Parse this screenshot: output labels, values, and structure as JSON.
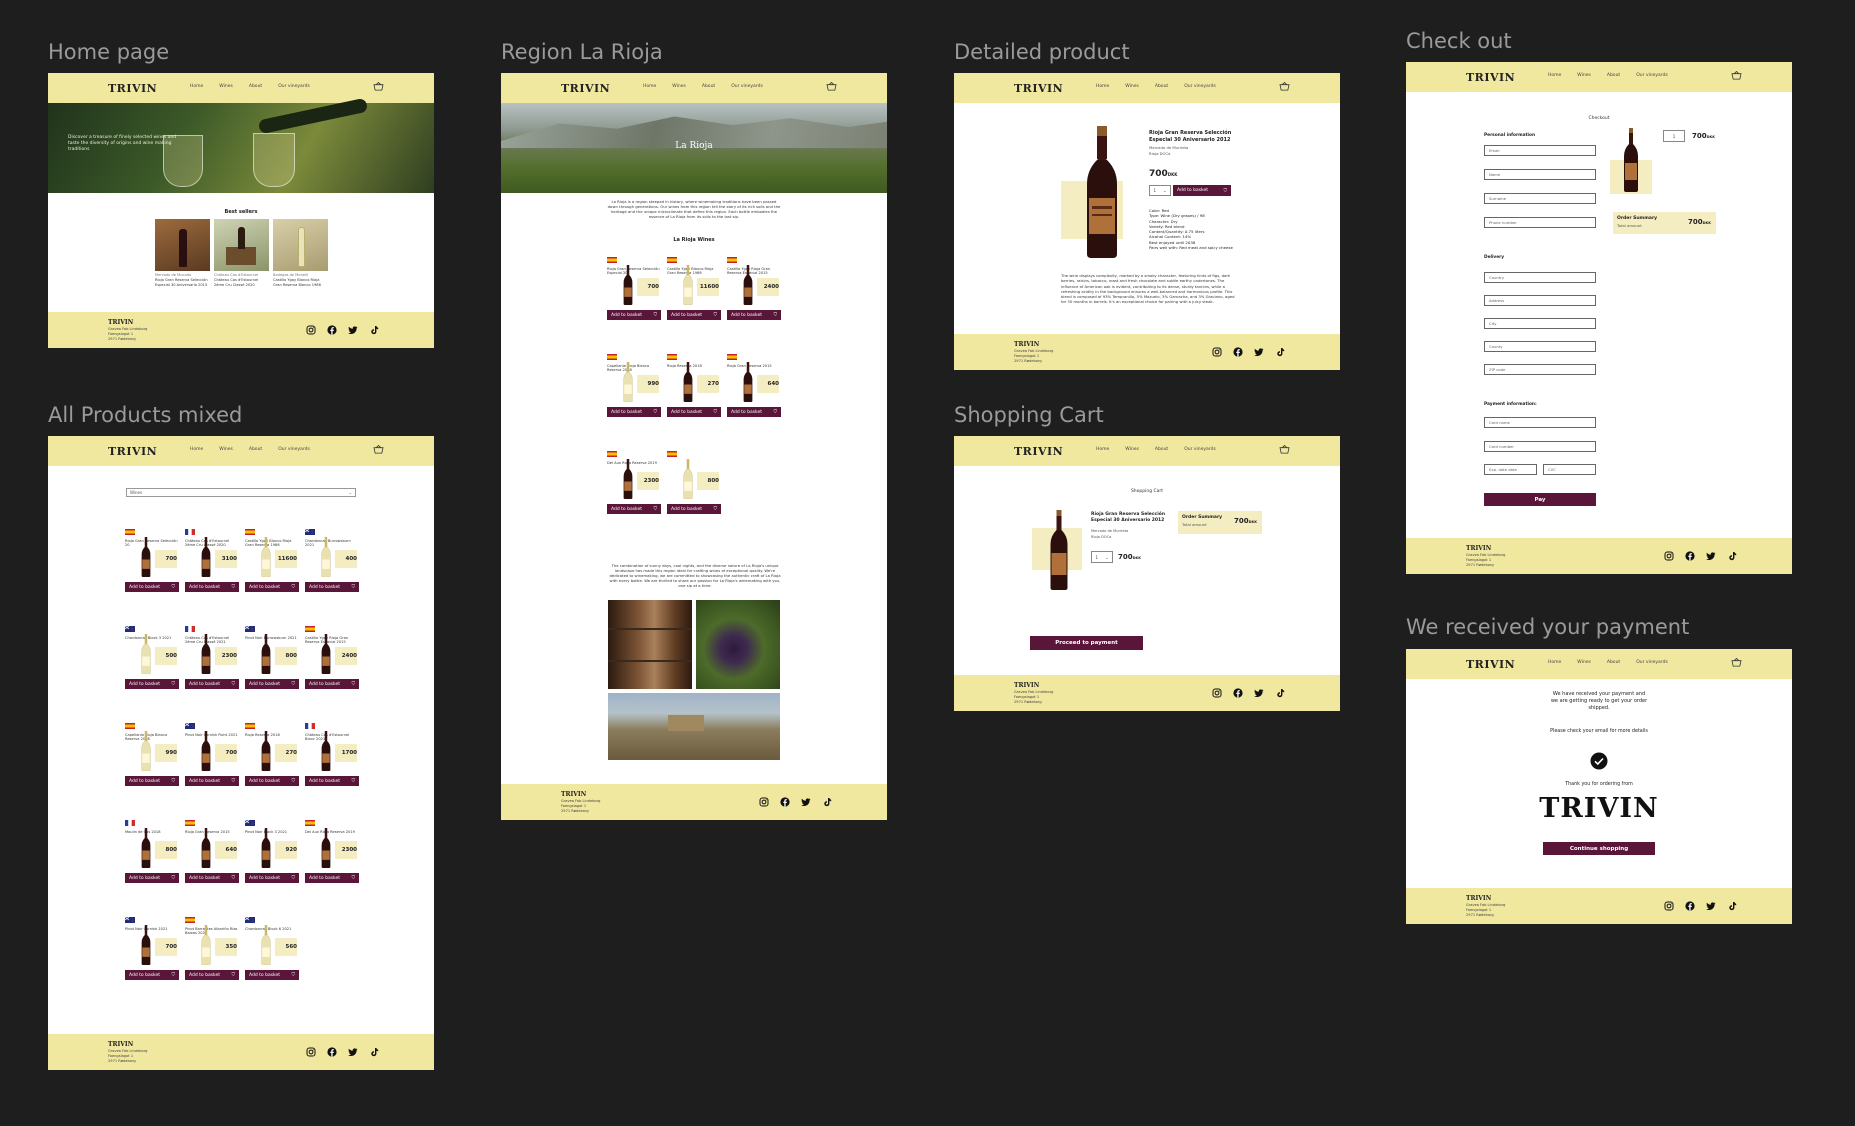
{
  "frames": {
    "home": "Home page",
    "region": "Region La Rioja",
    "detail": "Detailed product",
    "checkout": "Check out",
    "products": "All Products mixed",
    "cart": "Shopping Cart",
    "received": "We received your payment"
  },
  "brand": {
    "logo": "TRIVIN",
    "footer_logo": "TRIVIN",
    "address": [
      "Gravea Fab Lindeborg",
      "Faengslagot 1",
      "2971 Rødeborg"
    ]
  },
  "nav": {
    "home": "Home",
    "wines": "Wines",
    "about": "About",
    "vineyards": "Our vineyards"
  },
  "home": {
    "hero_text": "Discover a treasure of finely selected wines and taste the diversity of origins and wine making traditions",
    "best_sellers_title": "Best sellers",
    "best_sellers": [
      {
        "region": "Mercado de Mucado",
        "name": "Rioja Gran Reserva Selección Especial 30 Aniversario 2015"
      },
      {
        "region": "Château Cos d'Estournel",
        "name": "Château Cos d'Estournel 2ème Cru Classé 2020"
      },
      {
        "region": "Bodegas de Monelli",
        "name": "Castillo Ygay Blanco Rioja Gran Reserva Blanco 1986"
      }
    ]
  },
  "region": {
    "hero_title": "La Rioja",
    "intro": "La Rioja is a region steeped in history, where winemaking traditions have been passed down through generations. Our wines from this region tell the story of its rich soils and the heritage and the unique microclimate that define this region. Each bottle embodies the essence of La Rioja from its soils to the last sip.",
    "wines_title": "La Rioja Wines",
    "add_label": "Add to basket",
    "wines": [
      {
        "name": "Rioja Gran Reserva Selección Especial 20",
        "price": "700",
        "color": "red"
      },
      {
        "name": "Castillo Ygay Blanco Rioja Gran Reserva 1986",
        "price": "11600",
        "color": "white"
      },
      {
        "name": "Castillo Ygay Rioja Gran Reserva Especial 2015",
        "price": "2400",
        "color": "red"
      },
      {
        "name": "Capellania Rioja Blanco Reserva 2018",
        "price": "990",
        "color": "white"
      },
      {
        "name": "Rioja Reserva 2018",
        "price": "270",
        "color": "red"
      },
      {
        "name": "Rioja Gran Reserva 2015",
        "price": "640",
        "color": "red"
      },
      {
        "name": "Del Aux Rioja Reserva 2019",
        "price": "2300",
        "color": "red"
      },
      {
        "name": "",
        "price": "800",
        "color": "white"
      }
    ],
    "outro": "The combination of sunny days, cool nights, and the diverse nature of La Rioja's unique landscape has made this region ideal for crafting wines of exceptional quality. We're dedicated to winemaking, we are committed to showcasing the authentic craft of La Rioja with every bottle. We are thrilled to share our passion for La Rioja's winemaking with you, one sip at a time."
  },
  "detail": {
    "title": "Rioja Gran Reserva Selección Especial 30 Aniversario 2012",
    "producer": "Mercado de Murrieta",
    "doc": "Rioja DOCa",
    "price": "700",
    "currency": "DKK",
    "qty": "1",
    "add_label": "Add to basket",
    "specs": [
      "Color: Red",
      "Type: Wine (Dry grapes) / 98",
      "Character: Dry",
      "Variety: Red blend",
      "Content/Quantity: 0.75 liters",
      "Alcohol Content: 14%",
      "Best enjoyed until 2038",
      "Pairs well with: Red meat and spicy cheese"
    ],
    "description": "The wine displays complexity, marked by a smoky character, featuring hints of figs, dark berries, raisins, tobacco, roast and fresh chocolate and subtle earthy undertones. The influence of American oak is evident, contributing to its dense, sturdy tannins, while a refreshing acidity in the background ensures a well-balanced and harmonious profile. This blend is composed of 93% Tempranillo, 5% Mazuelo, 3% Garnacha, and 3% Graciano, aged for 30 months in barrels. It's an exceptional choice for pairing with a juicy steak."
  },
  "checkout": {
    "heading": "Checkout",
    "personal": "Personal information",
    "personal_fields": [
      "Email",
      "Name",
      "Surname",
      "Phone number"
    ],
    "delivery": "Delivery",
    "delivery_fields": [
      "Country",
      "Address",
      "City",
      "County",
      "ZIP code"
    ],
    "payment": "Payment information:",
    "payment_fields": [
      "Card name",
      "Card number"
    ],
    "exp": "Exp. date date",
    "cvc": "CVC",
    "pay": "Pay",
    "qty": "1",
    "price": "700",
    "currency": "DKK",
    "summary": "Order Summary",
    "total_label": "Total amount",
    "total": "700",
    "total_currency": "DKK"
  },
  "products": {
    "filter": "Wines",
    "add_label": "Add to basket",
    "items": [
      {
        "name": "Rioja Gran Reserva Selección 20",
        "price": "700",
        "flag": "es",
        "color": "red"
      },
      {
        "name": "Château Cos d'Estournel 2ème Cru Classé 2020",
        "price": "3100",
        "flag": "fr",
        "color": "red"
      },
      {
        "name": "Castillo Ygay Blanco Rioja Gran Reserva 1986",
        "price": "11600",
        "flag": "es",
        "color": "white"
      },
      {
        "name": "Chardonnay Burrowsburn 2021",
        "price": "400",
        "flag": "nz",
        "color": "white"
      },
      {
        "name": "Chardonnay Block 3 2021",
        "price": "500",
        "flag": "nz",
        "color": "white"
      },
      {
        "name": "Château Cos d'Estournel 2ème Cru Classé 2021",
        "price": "2300",
        "flag": "fr",
        "color": "red"
      },
      {
        "name": "Pinot Noir Burrowsburn 2021",
        "price": "800",
        "flag": "nz",
        "color": "red"
      },
      {
        "name": "Castillo Ygay Rioja Gran Reserva Especial 2015",
        "price": "2400",
        "flag": "es",
        "color": "red"
      },
      {
        "name": "Capellania Rioja Blanco Reserva 2018",
        "price": "990",
        "flag": "es",
        "color": "white"
      },
      {
        "name": "Pinot Noir Cornish Point 2021",
        "price": "700",
        "flag": "nz",
        "color": "red"
      },
      {
        "name": "Rioja Reserva 2018",
        "price": "270",
        "flag": "es",
        "color": "red"
      },
      {
        "name": "Château Cos d'Estournel Blanc 2021",
        "price": "1700",
        "flag": "fr",
        "color": "red"
      },
      {
        "name": "Moulin de Cos 2018",
        "price": "800",
        "flag": "fr",
        "color": "red"
      },
      {
        "name": "Rioja Gran Reserva 2015",
        "price": "640",
        "flag": "es",
        "color": "red"
      },
      {
        "name": "Pinot Noir Block 3 2021",
        "price": "920",
        "flag": "nz",
        "color": "red"
      },
      {
        "name": "Del Aux Rioja Reserva 2019",
        "price": "2300",
        "flag": "es",
        "color": "red"
      },
      {
        "name": "Pinot Noir Cornish 2021",
        "price": "700",
        "flag": "nz",
        "color": "red"
      },
      {
        "name": "Pinot Barrantes Albariño Rías Baixas 2020",
        "price": "350",
        "flag": "es",
        "color": "white"
      },
      {
        "name": "Chardonnay Block 6 2021",
        "price": "560",
        "flag": "nz",
        "color": "white"
      }
    ]
  },
  "cart": {
    "heading": "Shopping Cart",
    "title": "Rioja Gran Reserva Selección Especial 30 Aniversario 2012",
    "producer": "Mercado de Murrieta",
    "doc": "Rioja DOCa",
    "qty": "1",
    "price": "700",
    "currency": "DKK",
    "summary": "Order Summary",
    "total_label": "Total amount",
    "total": "700",
    "total_currency": "DKK",
    "proceed": "Proceed to payment"
  },
  "received": {
    "line1": "We have received your payment and we are getting ready to get your order shipped.",
    "line2": "Please check your email for more details",
    "thanks": "Thank you for ordering from",
    "logo": "TRIVIN",
    "continue": "Continue shopping"
  },
  "colors": {
    "accent": "#5a1639",
    "cream": "#f1e89f",
    "canvas": "#1e1e1e"
  }
}
